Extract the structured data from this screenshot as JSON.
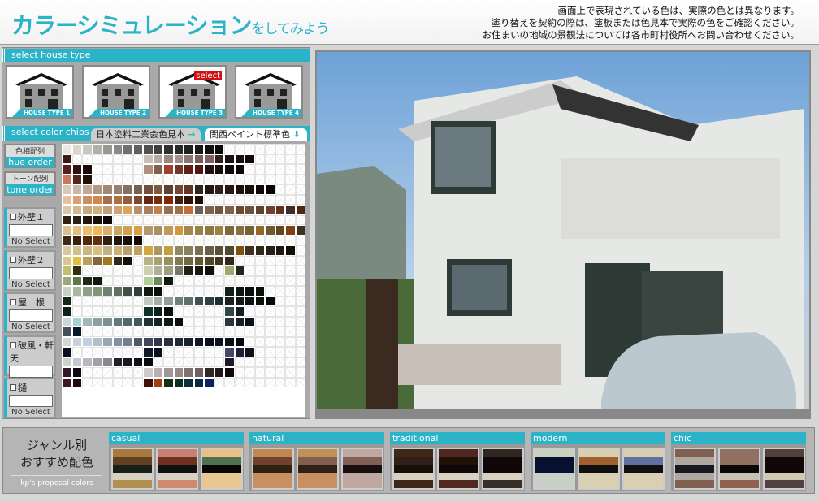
{
  "header": {
    "title": "カラーシミュレーション",
    "title_suffix": "をしてみよう",
    "notice": [
      "画面上で表現されている色は、実際の色とは異なります。",
      "塗り替えを契約の際は、塗板または色見本で実際の色をご確認ください。",
      "お住まいの地域の景観法については各市町村役所へお問い合わせください。"
    ]
  },
  "house_type": {
    "header": "select house type",
    "select_badge": "select",
    "selected": 3,
    "items": [
      {
        "label": "HOUSE TYPE 1"
      },
      {
        "label": "HOUSE TYPE 2"
      },
      {
        "label": "HOUSE TYPE 3"
      },
      {
        "label": "HOUSE TYPE 4"
      }
    ]
  },
  "color_chips": {
    "header": "select color chips",
    "tabs": [
      {
        "label": "日本塗料工業会色見本",
        "icon": "arrow-right-icon"
      },
      {
        "label": "関西ペイント標準色",
        "icon": "arrow-down-icon",
        "active": true
      }
    ],
    "order_buttons": [
      {
        "jp": "色相配列",
        "en": "hue order"
      },
      {
        "jp": "トーン配列",
        "en": "tone order"
      }
    ],
    "parts": [
      {
        "label": "外壁１",
        "value": "No Select"
      },
      {
        "label": "外壁２",
        "value": "No Select"
      },
      {
        "label": "屋　根",
        "value": "No Select"
      },
      {
        "label": "破風・軒天",
        "value": "No Select"
      },
      {
        "label": "樋",
        "value": "No Select"
      }
    ],
    "grid_columns": 24,
    "rows": [
      [
        [
          0,
          [
            "#e8e8e0",
            "#d8d8cc",
            "#c8c8bc",
            "#b0b0a8",
            "#989890",
            "#888884",
            "#707070",
            "#606060",
            "#505050",
            "#404040",
            "#303030",
            "#282828",
            "#202020",
            "#181818",
            "#101010",
            "#080808"
          ]
        ]
      ],
      [
        [
          0,
          [
            "#3a1a1a"
          ]
        ],
        [
          8,
          [
            "#c8c0b8",
            "#b8a8a0",
            "#988880",
            "#a09090",
            "#887870",
            "#786058",
            "#806060",
            "#302020",
            "#201010",
            "#181010",
            "#100808"
          ]
        ]
      ],
      [
        [
          0,
          [
            "#5a2020",
            "#301010",
            "#180808"
          ]
        ],
        [
          8,
          [
            "#b09080",
            "#806050",
            "#a04030",
            "#703828",
            "#602018",
            "#501810",
            "#201010",
            "#180c08",
            "#100808",
            "#0c0808"
          ]
        ]
      ],
      [
        [
          0,
          [
            "#c87860",
            "#502820",
            "#201008"
          ]
        ]
      ],
      [
        [
          0,
          [
            "#d8c8b8",
            "#c8b8a8",
            "#c0a898",
            "#b09888",
            "#a08878",
            "#988070",
            "#887060",
            "#786050",
            "#705040",
            "#805840",
            "#604030",
            "#704838",
            "#603828",
            "#302820",
            "#201810",
            "#302018",
            "#281810",
            "#201008",
            "#181008",
            "#100808",
            "#080404"
          ]
        ]
      ],
      [
        [
          0,
          [
            "#e8c0a0",
            "#d8a078",
            "#c89060",
            "#d08850",
            "#a07050",
            "#b07040",
            "#906040",
            "#804830",
            "#602818",
            "#703010",
            "#802808",
            "#402010",
            "#301008",
            "#200c04"
          ]
        ]
      ],
      [
        [
          0,
          [
            "#d8c8a8",
            "#d0b890",
            "#c8a880",
            "#d0b080",
            "#c0a078",
            "#d0a070",
            "#e0a060",
            "#b09070",
            "#a88060",
            "#c08050",
            "#987050",
            "#a07048",
            "#c07038",
            "#686058",
            "#806050",
            "#705840",
            "#806048",
            "#704830",
            "#705038",
            "#604030",
            "#704030",
            "#603020",
            "#383028",
            "#502810"
          ]
        ]
      ],
      [
        [
          0,
          [
            "#302010",
            "#282018",
            "#201810",
            "#181008",
            "#100808"
          ]
        ]
      ],
      [
        [
          0,
          [
            "#d8c090",
            "#e0c080",
            "#e8c070",
            "#f0b858",
            "#d8b070",
            "#c8a860",
            "#d0a050",
            "#d8a040",
            "#b09870",
            "#a89060",
            "#c09858",
            "#d09840",
            "#a08850",
            "#988048",
            "#907840",
            "#a08040",
            "#806838",
            "#887040",
            "#786030",
            "#906828",
            "#705830",
            "#604820",
            "#804010",
            "#403020"
          ]
        ]
      ],
      [
        [
          0,
          [
            "#402818",
            "#382010",
            "#502810",
            "#603010",
            "#302010",
            "#201810",
            "#181008",
            "#100c08"
          ]
        ]
      ],
      [
        [
          0,
          [
            "#d8c8a0",
            "#d0c090",
            "#c8b880",
            "#d8c080",
            "#c0b088",
            "#c8b078",
            "#b8a070",
            "#c0a060",
            "#d0a840",
            "#a89868",
            "#c0a040",
            "#908860",
            "#888060",
            "#787050",
            "#686048",
            "#585038",
            "#504830",
            "#805010",
            "#403020",
            "#302818",
            "#282018",
            "#201810",
            "#101008"
          ]
        ]
      ],
      [
        [
          0,
          [
            "#d8c890",
            "#e0c040",
            "#b8a060",
            "#806838",
            "#a07820",
            "#302818",
            "#181008"
          ]
        ],
        [
          8,
          [
            "#b8b088",
            "#a8a070",
            "#989060",
            "#807850",
            "#706840",
            "#605830",
            "#504828",
            "#403820",
            "#302818"
          ]
        ]
      ],
      [
        [
          0,
          [
            "#c0c070",
            "#303010"
          ]
        ],
        [
          8,
          [
            "#d0d0b0",
            "#b0b098",
            "#a0a080",
            "#787868",
            "#202018",
            "#181810",
            "#101008"
          ]
        ],
        [
          16,
          [
            "#a0a870",
            "#202818"
          ]
        ]
      ],
      [
        [
          0,
          [
            "#98a880",
            "#607848",
            "#202818",
            "#101810"
          ]
        ],
        [
          8,
          [
            "#b0d098",
            "#708860",
            "#101810"
          ]
        ]
      ],
      [
        [
          0,
          [
            "#c8d0c0",
            "#a8b8a0",
            "#90a088",
            "#809878",
            "#708070",
            "#607060",
            "#405048",
            "#304038",
            "#101810",
            "#081008"
          ]
        ],
        [
          16,
          [
            "#102018",
            "#081810",
            "#041008",
            "#081008"
          ]
        ]
      ],
      [
        [
          0,
          [
            "#102818"
          ]
        ],
        [
          8,
          [
            "#c0c8c0",
            "#a0b0a8",
            "#90a098",
            "#708078",
            "#607068",
            "#405050",
            "#304040",
            "#203030",
            "#182020",
            "#101818",
            "#081410",
            "#081008",
            "#040804"
          ]
        ]
      ],
      [
        [
          0,
          [
            "#102018"
          ]
        ],
        [
          8,
          [
            "#103028",
            "#082018",
            "#041008"
          ]
        ],
        [
          16,
          [
            "#304848",
            "#102020"
          ]
        ]
      ],
      [
        [
          0,
          [
            "#c8d8d8",
            "#a8d0d0",
            "#a0b8b8",
            "#90a0a0",
            "#809090",
            "#607880",
            "#506870",
            "#405860",
            "#203038",
            "#182028",
            "#101818",
            "#081010"
          ]
        ],
        [
          16,
          [
            "#283840",
            "#182028",
            "#081018"
          ]
        ]
      ],
      [
        [
          0,
          [
            "#485060",
            "#081828"
          ]
        ]
      ],
      [
        [
          0,
          [
            "#d0d8d8",
            "#c8d0d8",
            "#c0d0e0",
            "#b0c0c8",
            "#98a8b0",
            "#8090a0",
            "#708090",
            "#505868",
            "#404858",
            "#303848",
            "#283040",
            "#202838",
            "#182030",
            "#101828",
            "#081020",
            "#101020",
            "#081018",
            "#040810"
          ]
        ]
      ],
      [
        [
          0,
          [
            "#081020"
          ]
        ],
        [
          8,
          [
            "#101828",
            "#081020"
          ]
        ],
        [
          16,
          [
            "#484868",
            "#202038",
            "#101018"
          ]
        ]
      ],
      [
        [
          0,
          [
            "#d0d0d0",
            "#c8c8d0",
            "#b8b8c0",
            "#a0a0a8",
            "#888890",
            "#202028",
            "#181820",
            "#101018",
            "#080810"
          ]
        ],
        [
          16,
          [
            "#201828"
          ]
        ]
      ],
      [
        [
          0,
          [
            "#301828",
            "#100810"
          ]
        ],
        [
          8,
          [
            "#d0c8c8",
            "#b8b0b0",
            "#a09898",
            "#988888",
            "#807070",
            "#706060",
            "#302828",
            "#201818",
            "#100808"
          ]
        ]
      ],
      [
        [
          0,
          [
            "#401820",
            "#200810"
          ]
        ],
        [
          8,
          [
            "#401008",
            "#a04010",
            "#103018",
            "#083020",
            "#083038",
            "#082848",
            "#102060"
          ]
        ]
      ]
    ]
  },
  "proposal": {
    "title_lines": [
      "ジャンル別",
      "おすすめ配色"
    ],
    "subtitle": "kp's proposal colors",
    "genres": [
      {
        "name": "casual",
        "swatches": [
          [
            "#a87840",
            "#604020",
            "#182018",
            "#d8d0c0",
            "#b09050"
          ],
          [
            "#c88070",
            "#703020",
            "#101010",
            "#d8d0c0",
            "#d08870"
          ],
          [
            "#e8c088",
            "#507050",
            "#080808",
            "#e8c890",
            "#e8c890"
          ]
        ]
      },
      {
        "name": "natural",
        "swatches": [
          [
            "#c08850",
            "#704030",
            "#302010",
            "#c89060",
            "#c89060"
          ],
          [
            "#c09058",
            "#806050",
            "#302018",
            "#c89060",
            "#c89060"
          ],
          [
            "#c0a8a0",
            "#806058",
            "#181010",
            "#c0a8a0",
            "#c0a8a0"
          ]
        ]
      },
      {
        "name": "traditional",
        "swatches": [
          [
            "#402818",
            "#302018",
            "#181008",
            "#d8d0c0",
            "#402818"
          ],
          [
            "#502820",
            "#201008",
            "#100808",
            "#d8d0c0",
            "#502820"
          ],
          [
            "#302820",
            "#100808",
            "#100808",
            "#d8d0c0",
            "#383028"
          ]
        ]
      },
      {
        "name": "modern",
        "swatches": [
          [
            "#c8d0c0",
            "#081030",
            "#081030",
            "#c8d0c8",
            "#c8d0c8"
          ],
          [
            "#d8d0b0",
            "#a06030",
            "#101010",
            "#d8d0b0",
            "#d8d0b0"
          ],
          [
            "#d8d0b0",
            "#6070a0",
            "#101010",
            "#d8d0b0",
            "#d8d0b0"
          ]
        ]
      },
      {
        "name": "chic",
        "swatches": [
          [
            "#806050",
            "#b0a8a0",
            "#181820",
            "#b0a8a0",
            "#806050"
          ],
          [
            "#907060",
            "#907060",
            "#080808",
            "#c8c0b0",
            "#906050"
          ],
          [
            "#504038",
            "#100808",
            "#100808",
            "#d0c8b0",
            "#504040"
          ]
        ]
      }
    ]
  },
  "colors": {
    "accent": "#2bb3c8",
    "select_badge": "#d01010"
  }
}
